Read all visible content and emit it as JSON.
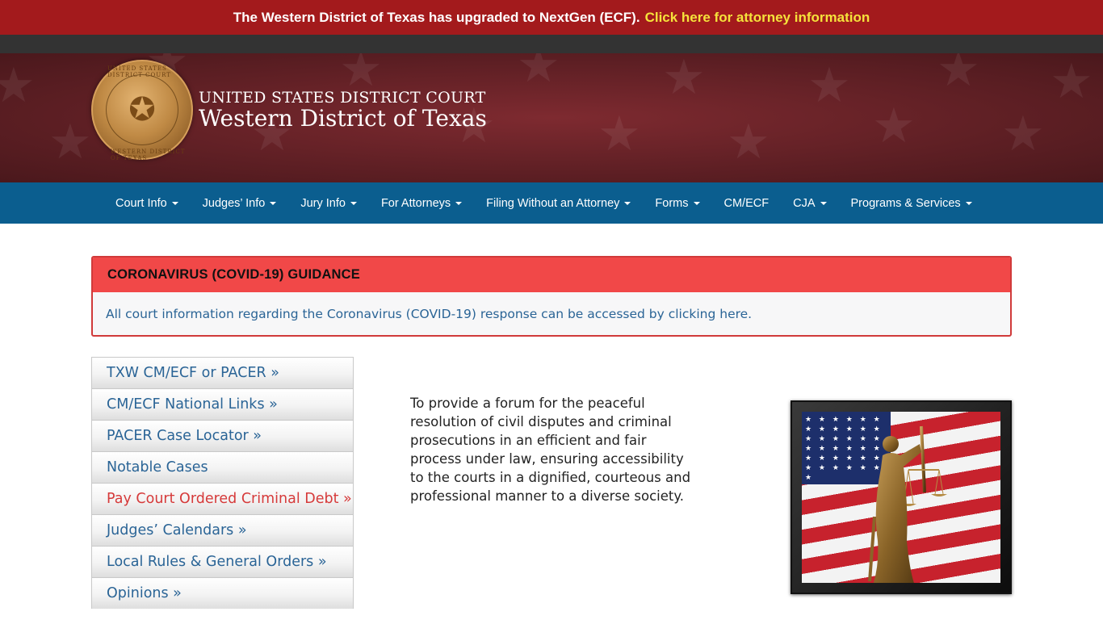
{
  "alert": {
    "message": "The Western District of Texas has upgraded to NextGen (ECF).",
    "link": "Click here for attorney information"
  },
  "header": {
    "line1": "UNITED STATES DISTRICT COURT",
    "line2": "Western District of Texas",
    "seal_top": "UNITED STATES DISTRICT COURT",
    "seal_bottom": "WESTERN DISTRICT OF TEXAS"
  },
  "nav": {
    "items": [
      {
        "label": "Court Info",
        "dropdown": true
      },
      {
        "label": "Judges’ Info",
        "dropdown": true
      },
      {
        "label": "Jury Info",
        "dropdown": true
      },
      {
        "label": "For Attorneys",
        "dropdown": true
      },
      {
        "label": "Filing Without an Attorney",
        "dropdown": true
      },
      {
        "label": "Forms",
        "dropdown": true
      },
      {
        "label": "CM/ECF",
        "dropdown": false
      },
      {
        "label": "CJA",
        "dropdown": true
      },
      {
        "label": "Programs & Services",
        "dropdown": true
      }
    ]
  },
  "covid": {
    "title": "CORONAVIRUS (COVID-19) GUIDANCE",
    "body": "All court information regarding the Coronavirus (COVID-19) response can be accessed by clicking here."
  },
  "sidebar": {
    "items": [
      {
        "label": "TXW CM/ECF or PACER »"
      },
      {
        "label": "CM/ECF National Links »"
      },
      {
        "label": "PACER Case Locator »"
      },
      {
        "label": "Notable Cases"
      },
      {
        "label": "Pay Court Ordered Criminal Debt »",
        "color": "#d63a3a"
      },
      {
        "label": "Judges’ Calendars »"
      },
      {
        "label": "Local Rules & General Orders »"
      },
      {
        "label": "Opinions »"
      }
    ]
  },
  "mission": {
    "text": "To provide a forum for the peaceful resolution of civil disputes and criminal prosecutions in an efficient and fair process under law, ensuring accessibility to the courts in a dignified, courteous and professional manner to a diverse society."
  },
  "colors": {
    "alert_bg": "#a31a1c",
    "alert_link": "#f5e23b",
    "nav_bg": "#0b5e8f",
    "covid_header": "#f14848",
    "link_blue": "#2a6496"
  }
}
